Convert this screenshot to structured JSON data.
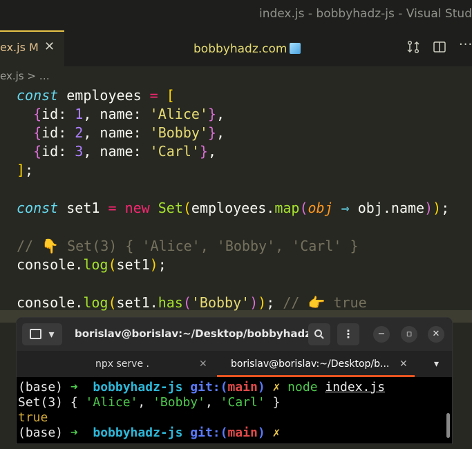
{
  "window": {
    "title": "index.js - bobbyhadz-js - Visual Stud"
  },
  "tab": {
    "label": "ex.js M",
    "close": "✕"
  },
  "header": {
    "center_title": "bobbyhadz.com"
  },
  "breadcrumb": {
    "text": "ex.js > …"
  },
  "code": [
    [
      "const",
      " employees ",
      "=",
      " [",
      ""
    ],
    [
      "  {id: 1, name: 'Alice'},"
    ],
    [
      "  {id: 2, name: 'Bobby'},"
    ],
    [
      "  {id: 3, name: 'Carl'},"
    ],
    [
      "];"
    ]
  ],
  "code_text": {
    "l1_const": "const",
    "l1_name": " employees ",
    "l1_eq": "=",
    "l1_br": " [",
    "l2_a": "  {",
    "l2_b": "id: ",
    "l2_n": "1",
    "l2_c": ", name: ",
    "l2_s": "'Alice'",
    "l2_d": "}",
    "l2_e": ",",
    "l3_a": "  {",
    "l3_b": "id: ",
    "l3_n": "2",
    "l3_c": ", name: ",
    "l3_s": "'Bobby'",
    "l3_d": "}",
    "l3_e": ",",
    "l4_a": "  {",
    "l4_b": "id: ",
    "l4_n": "3",
    "l4_c": ", name: ",
    "l4_s": "'Carl'",
    "l4_d": "}",
    "l4_e": ",",
    "l5_a": "]",
    "l5_b": ";",
    "l7_const": "const",
    "l7_a": " set1 ",
    "l7_eq": "=",
    "l7_sp": " ",
    "l7_new": "new",
    "l7_sp2": " ",
    "l7_set": "Set",
    "l7_p1": "(",
    "l7_emp": "employees.",
    "l7_map": "map",
    "l7_p2": "(",
    "l7_obj": "obj",
    "l7_sp3": " ",
    "l7_arrow": "⇒",
    "l7_rest": " obj.name",
    "l7_p3": ")",
    "l7_p4": ")",
    "l7_semi": ";",
    "l9": "// 👇 Set(3) { 'Alice', 'Bobby', 'Carl' }",
    "l10_a": "console.",
    "l10_fn": "log",
    "l10_p1": "(",
    "l10_arg": "set1",
    "l10_p2": ")",
    "l10_semi": ";",
    "l12_a": "console.",
    "l12_fn": "log",
    "l12_p1": "(",
    "l12_b": "set1.",
    "l12_has": "has",
    "l12_p2": "(",
    "l12_s": "'Bobby'",
    "l12_p3": ")",
    "l12_p4": ")",
    "l12_semi": "; ",
    "l12_cm": "// 👉 true"
  },
  "terminal": {
    "title": "borislav@borislav:~/Desktop/bobbyhadz-r...",
    "tabs": [
      {
        "label": "npx serve ."
      },
      {
        "label": "borislav@borislav:~/Desktop/b..."
      }
    ],
    "close_glyph": "✕",
    "lines": {
      "l1_base": "(base) ",
      "l1_arrow": "➜",
      "l1_dir": "  bobbyhadz-js ",
      "l1_git": "git:(",
      "l1_branch": "main",
      "l1_git2": ")",
      "l1_x": " ✗",
      "l1_cmd": " node ",
      "l1_file": "index.js",
      "l2_a": "Set(3) { ",
      "l2_s1": "'Alice'",
      "l2_c1": ", ",
      "l2_s2": "'Bobby'",
      "l2_c2": ", ",
      "l2_s3": "'Carl'",
      "l2_b": " }",
      "l3": "true",
      "l4_base": "(base) ",
      "l4_arrow": "➜",
      "l4_dir": "  bobbyhadz-js ",
      "l4_git": "git:(",
      "l4_branch": "main",
      "l4_git2": ")",
      "l4_x": " ✗"
    }
  }
}
